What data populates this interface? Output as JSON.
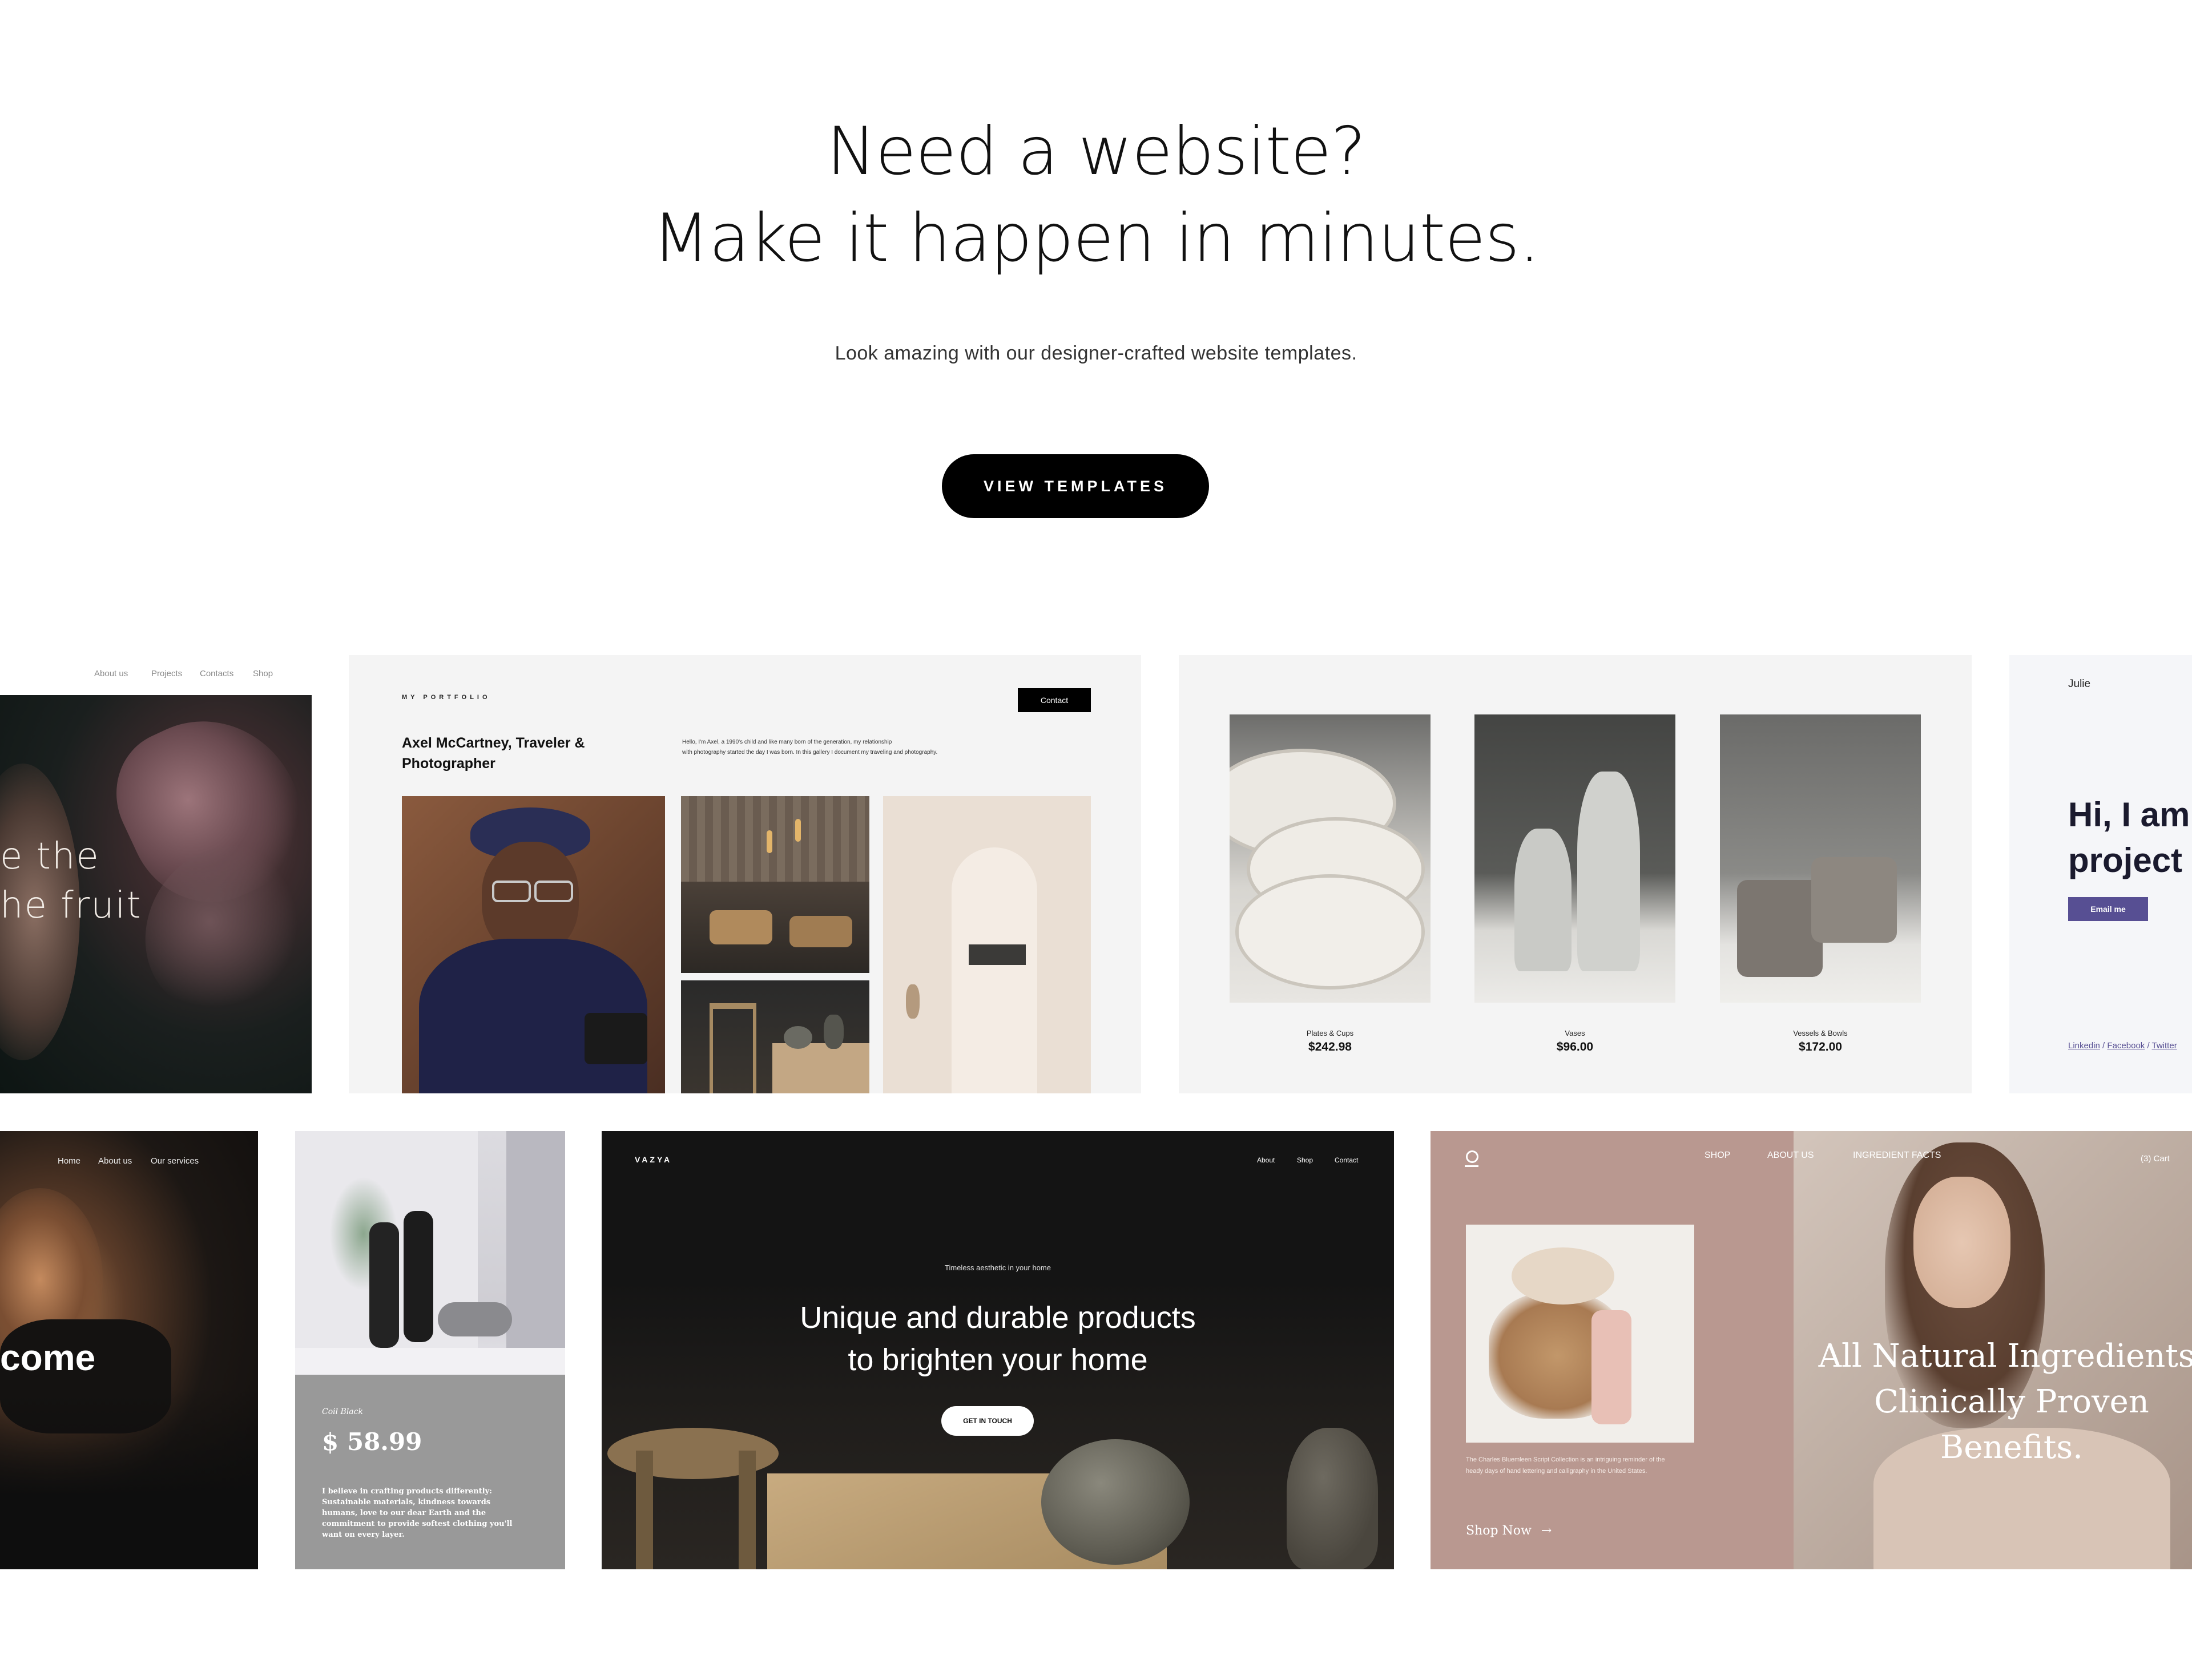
{
  "hero": {
    "title_line1": "Need a website?",
    "title_line2": "Make it happen in minutes.",
    "subtitle": "Look amazing with our designer-crafted website templates.",
    "cta_label": "VIEW TEMPLATES"
  },
  "templates": {
    "t1": {
      "nav": [
        "About us",
        "Projects",
        "Contacts",
        "Shop"
      ],
      "headline_line1": "e the",
      "headline_line2": "he fruit"
    },
    "t2": {
      "label": "MY PORTFOLIO",
      "contact_button": "Contact",
      "name": "Axel McCartney, Traveler & Photographer",
      "bio_line1": "Hello, I'm Axel, a 1990's child and like many born of the generation, my relationship",
      "bio_line2": "with photography started the day I was born. In this gallery I document my traveling and photography."
    },
    "t3": {
      "products": [
        {
          "name": "Plates & Cups",
          "price": "$242.98"
        },
        {
          "name": "Vases",
          "price": "$96.00"
        },
        {
          "name": "Vessels & Bowls",
          "price": "$172.00"
        }
      ]
    },
    "t4": {
      "name": "Julie",
      "headline_line1": "Hi, I am",
      "headline_line2": "project m",
      "button": "Email me",
      "links": [
        "Linkedin",
        "Facebook",
        "Twitter"
      ]
    },
    "t5": {
      "nav": [
        "Home",
        "About us",
        "Our services"
      ],
      "headline": "come"
    },
    "t6": {
      "product_name": "Coil Black",
      "price": "$ 58.99",
      "description": "I believe in crafting products differently: Sustainable materials, kindness towards humans, love to our dear Earth and the commitment to provide softest clothing you'll want on every layer."
    },
    "t7": {
      "brand": "VAZYA",
      "nav": [
        "About",
        "Shop",
        "Contact"
      ],
      "eyebrow": "Timeless aesthetic in your home",
      "headline_line1": "Unique and durable products",
      "headline_line2": "to brighten your home",
      "button": "GET IN TOUCH"
    },
    "t8": {
      "nav": [
        "SHOP",
        "ABOUT US",
        "INGREDIENT FACTS"
      ],
      "cart": "(3) Cart",
      "body_text": "The Charles Bluemleen Script Collection is an intriguing reminder of the heady days of hand lettering and calligraphy in the United States.",
      "shop_link": "Shop Now",
      "headline_line1": "All Natural Ingredients.",
      "headline_line2": "Clinically Proven",
      "headline_line3": "Benefits."
    }
  },
  "colors": {
    "cta_bg": "#000000",
    "card_bg": "#f4f4f4",
    "accent_purple": "#574f93",
    "rose": "#b99890"
  }
}
